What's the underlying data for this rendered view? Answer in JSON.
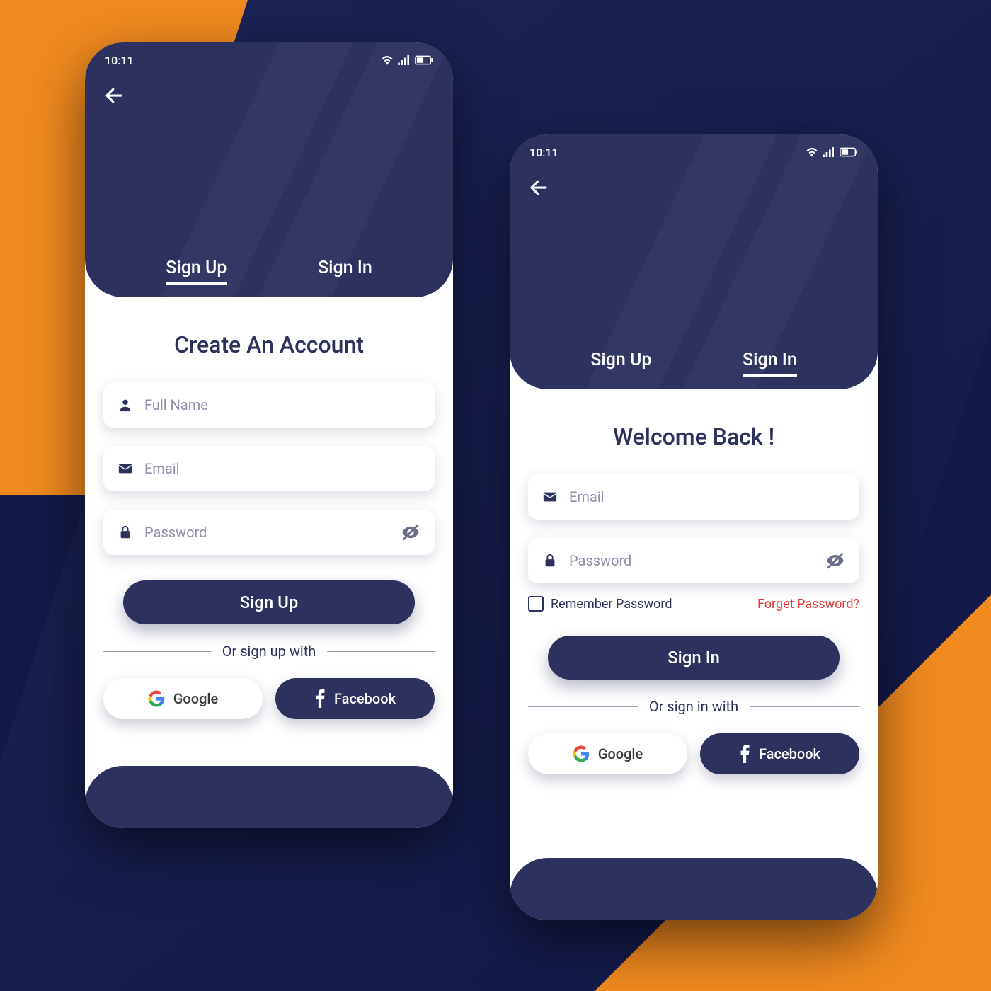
{
  "status": {
    "time": "10:11"
  },
  "tabs": {
    "signup": "Sign Up",
    "signin": "Sign In"
  },
  "signup": {
    "title": "Create An Account",
    "fullname_placeholder": "Full Name",
    "email_placeholder": "Email",
    "password_placeholder": "Password",
    "submit": "Sign Up",
    "divider": "Or sign up with",
    "google": "Google",
    "facebook": "Facebook"
  },
  "signin": {
    "title": "Welcome Back !",
    "email_placeholder": "Email",
    "password_placeholder": "Password",
    "remember": "Remember Password",
    "forget": "Forget Password?",
    "submit": "Sign In",
    "divider": "Or sign in with",
    "google": "Google",
    "facebook": "Facebook"
  }
}
